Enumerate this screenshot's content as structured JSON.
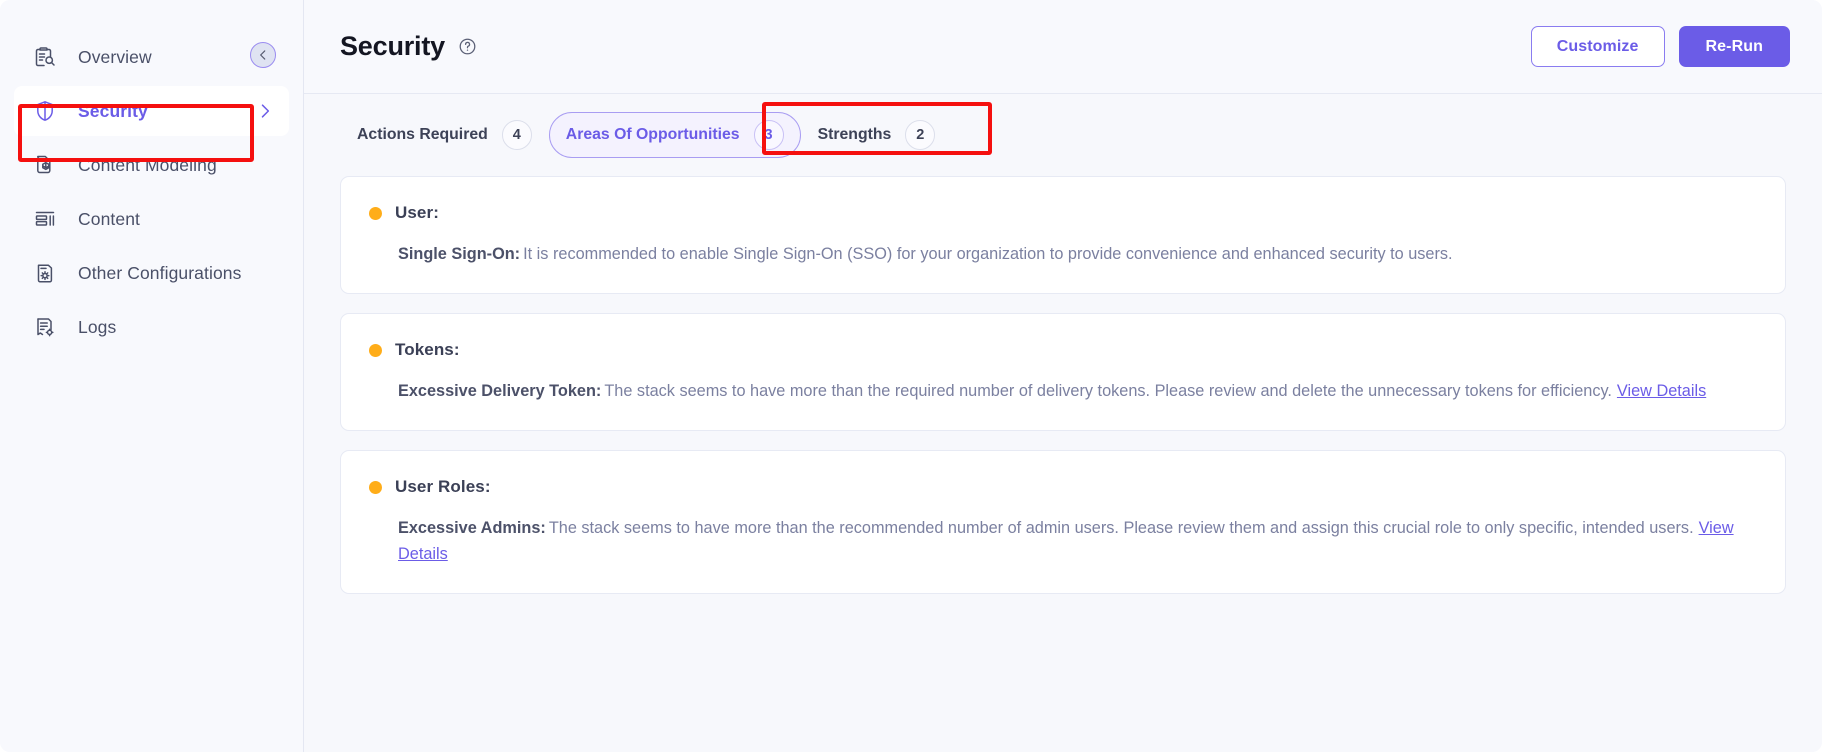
{
  "sidebar": {
    "items": [
      {
        "label": "Overview",
        "icon": "clipboard-search-icon",
        "active": false,
        "chevron": false
      },
      {
        "label": "Security",
        "icon": "shield-icon",
        "active": true,
        "chevron": true
      },
      {
        "label": "Content Modeling",
        "icon": "document-cube-icon",
        "active": false,
        "chevron": false
      },
      {
        "label": "Content",
        "icon": "list-layout-icon",
        "active": false,
        "chevron": false
      },
      {
        "label": "Other Configurations",
        "icon": "document-gear-icon",
        "active": false,
        "chevron": false
      },
      {
        "label": "Logs",
        "icon": "document-log-icon",
        "active": false,
        "chevron": false
      }
    ]
  },
  "header": {
    "collapse_icon": "chevron-left-icon",
    "title": "Security",
    "help_icon": "question-circle-icon",
    "customize_label": "Customize",
    "rerun_label": "Re-Run"
  },
  "tabs": [
    {
      "label": "Actions Required",
      "count": "4",
      "selected": false
    },
    {
      "label": "Areas Of Opportunities",
      "count": "3",
      "selected": true
    },
    {
      "label": "Strengths",
      "count": "2",
      "selected": false
    }
  ],
  "cards": [
    {
      "title": "User:",
      "status_color": "#ffad19",
      "lead": "Single Sign-On:",
      "text": "It is recommended to enable Single Sign-On (SSO) for your organization to provide convenience and enhanced security to users.",
      "link": ""
    },
    {
      "title": "Tokens:",
      "status_color": "#ffad19",
      "lead": "Excessive Delivery Token:",
      "text": "The stack seems to have more than the required number of delivery tokens. Please review and delete the unnecessary tokens for efficiency.",
      "link": "View Details"
    },
    {
      "title": "User Roles:",
      "status_color": "#ffad19",
      "lead": "Excessive Admins:",
      "text": "The stack seems to have more than the recommended number of admin users. Please review them and assign this crucial role to only specific, intended users.",
      "link": "View Details"
    }
  ],
  "annotations": {
    "highlight_color": "#f5100f",
    "sidebar_target": "Security",
    "tab_target": "Areas Of Opportunities"
  },
  "theme": {
    "accent": "#6b5ce7",
    "status_warning": "#ffad19",
    "page_bg": "#f7f8fc"
  }
}
